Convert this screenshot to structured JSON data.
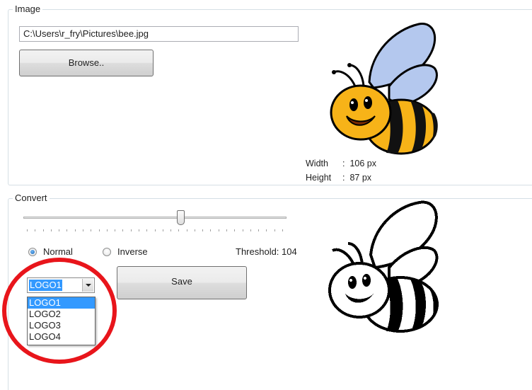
{
  "image_group": {
    "title": "Image",
    "path_value": "C:\\Users\\r_fry\\Pictures\\bee.jpg",
    "browse_label": "Browse..",
    "width_label": "Width",
    "width_value": "106 px",
    "height_label": "Height",
    "height_value": "87 px",
    "colon": ":"
  },
  "convert_group": {
    "title": "Convert",
    "threshold_label": "Threshold: 104",
    "threshold_value": 104,
    "threshold_fraction": 0.6,
    "radio_normal": "Normal",
    "radio_inverse": "Inverse",
    "selected_mode": "Normal",
    "save_label": "Save",
    "combo_value": "LOGO1",
    "combo_options": [
      "LOGO1",
      "LOGO2",
      "LOGO3",
      "LOGO4"
    ]
  },
  "colors": {
    "selection": "#3399ff",
    "annotation_circle": "#e8151b",
    "bee_yellow": "#f7b318",
    "bee_wing": "#b4c8ee"
  },
  "icons": {
    "combo_arrow": "chevron-down-icon",
    "color_preview": "bee-color-image",
    "bw_preview": "bee-monochrome-image"
  }
}
